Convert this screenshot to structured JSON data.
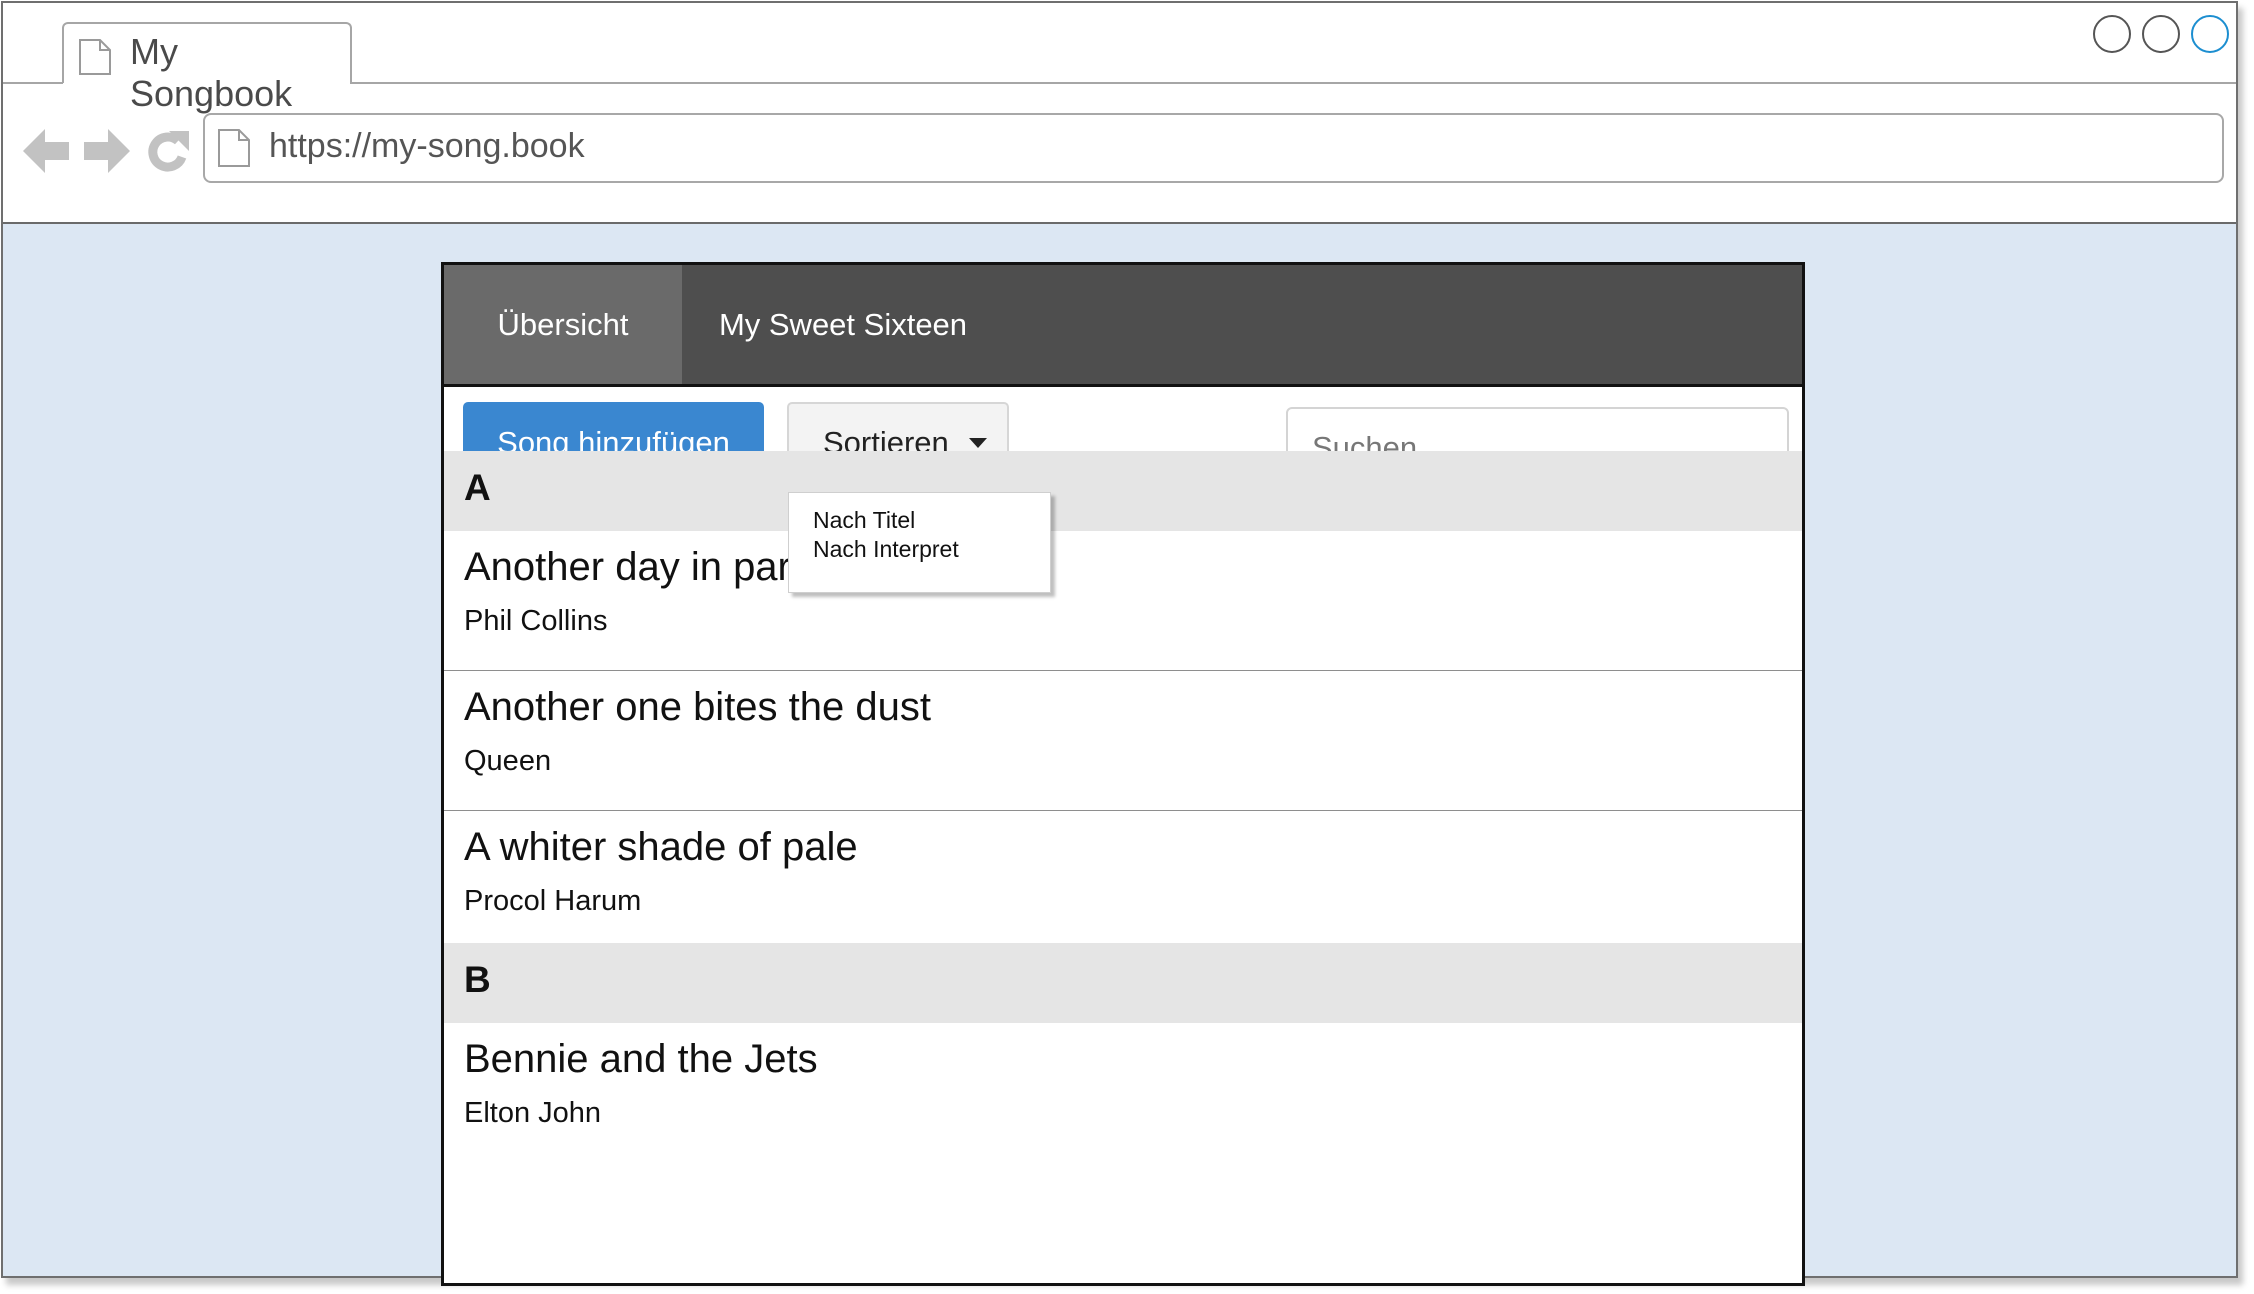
{
  "browser": {
    "tab_title": "My Songbook",
    "url": "https://my-song.book",
    "icons": {
      "tab": "page-icon",
      "back": "back-arrow-icon",
      "forward": "forward-arrow-icon",
      "reload": "reload-icon",
      "url": "page-icon"
    }
  },
  "nav": {
    "tabs": [
      {
        "label": "Übersicht",
        "active": true
      },
      {
        "label": "My Sweet Sixteen",
        "active": false
      }
    ]
  },
  "toolbar": {
    "add_label": "Song hinzufügen",
    "sort_label": "Sortieren",
    "sort_options": [
      "Nach Titel",
      "Nach Interpret"
    ],
    "search_placeholder": "Suchen",
    "search_value": ""
  },
  "songs": {
    "sections": [
      {
        "letter": "A",
        "items": [
          {
            "title": "Another day in paradise",
            "artist": "Phil Collins"
          },
          {
            "title": "Another one bites the dust",
            "artist": "Queen"
          },
          {
            "title": "A whiter shade of pale",
            "artist": "Procol Harum"
          }
        ]
      },
      {
        "letter": "B",
        "items": [
          {
            "title": "Bennie and the Jets",
            "artist": "Elton John"
          }
        ]
      }
    ]
  },
  "colors": {
    "primary_button": "#3a87d0",
    "navbar": "#4e4e4e",
    "navbar_active": "#6a6a6a",
    "page_background": "#dce7f3",
    "section_header": "#e5e5e5",
    "window_control_active": "#1c8ed0"
  }
}
